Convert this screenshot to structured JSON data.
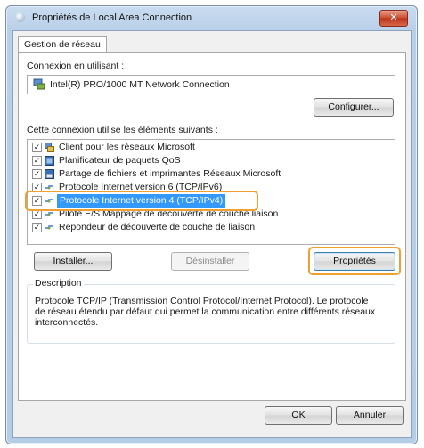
{
  "window": {
    "title": "Propriétés de Local Area Connection",
    "close_label": "✕"
  },
  "tab": {
    "label": "Gestion de réseau"
  },
  "connect_using": {
    "label": "Connexion en utilisant :",
    "adapter": "Intel(R) PRO/1000 MT Network Connection"
  },
  "configure_button": "Configurer...",
  "items_label": "Cette connexion utilise les éléments suivants :",
  "items": [
    {
      "label": "Client pour les réseaux Microsoft",
      "checked": true,
      "icon": "network-client-icon"
    },
    {
      "label": "Planificateur de paquets QoS",
      "checked": true,
      "icon": "qos-scheduler-icon"
    },
    {
      "label": "Partage de fichiers et imprimantes Réseaux Microsoft",
      "checked": true,
      "icon": "file-sharing-icon"
    },
    {
      "label": "Protocole Internet version 6 (TCP/IPv6)",
      "checked": true,
      "icon": "protocol-icon"
    },
    {
      "label": "Protocole Internet version 4 (TCP/IPv4)",
      "checked": true,
      "icon": "protocol-icon",
      "selected": true
    },
    {
      "label": "Pilote E/S Mappage de découverte de couche liaison",
      "checked": true,
      "icon": "protocol-icon"
    },
    {
      "label": "Répondeur de découverte de couche de liaison",
      "checked": true,
      "icon": "protocol-icon"
    }
  ],
  "buttons": {
    "install": "Installer...",
    "uninstall": "Désinstaller",
    "properties": "Propriétés"
  },
  "description": {
    "legend": "Description",
    "text": "Protocole TCP/IP (Transmission Control Protocol/Internet Protocol). Le protocole de réseau étendu par défaut qui permet la communication entre différents réseaux interconnectés."
  },
  "footer": {
    "ok": "OK",
    "cancel": "Annuler"
  },
  "colors": {
    "highlight": "#f0a030",
    "selection": "#3399ff"
  }
}
